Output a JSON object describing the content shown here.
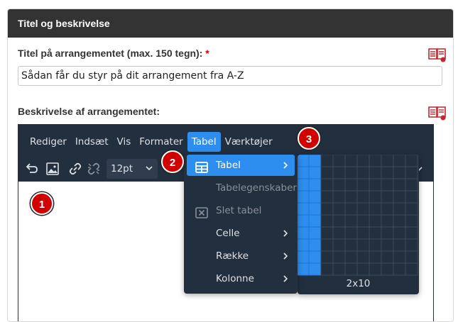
{
  "card": {
    "header": "Titel og beskrivelse"
  },
  "title_field": {
    "label": "Titel på arrangementet (max. 150 tegn):",
    "required_mark": "*",
    "value": "Sådan får du styr på dit arrangement fra A-Z"
  },
  "description_field": {
    "label": "Beskrivelse af arrangementet:"
  },
  "editor": {
    "menubar": [
      "Rediger",
      "Indsæt",
      "Vis",
      "Formater",
      "Tabel",
      "Værktøjer"
    ],
    "active_menu": "Tabel",
    "font_size": "12pt",
    "toolbar_icons": [
      "undo-icon",
      "image-icon",
      "link-icon",
      "unlink-icon"
    ]
  },
  "table_menu": {
    "items": [
      {
        "label": "Tabel",
        "icon": "table-icon",
        "submenu": true,
        "selected": true,
        "disabled": false
      },
      {
        "label": "Tabelegenskaber",
        "icon": "",
        "submenu": false,
        "selected": false,
        "disabled": true
      },
      {
        "label": "Slet tabel",
        "icon": "delete-table-icon",
        "submenu": false,
        "selected": false,
        "disabled": true
      },
      {
        "label": "Celle",
        "icon": "",
        "submenu": true,
        "selected": false,
        "disabled": false
      },
      {
        "label": "Række",
        "icon": "",
        "submenu": true,
        "selected": false,
        "disabled": false
      },
      {
        "label": "Kolonne",
        "icon": "",
        "submenu": true,
        "selected": false,
        "disabled": false
      }
    ]
  },
  "table_grid": {
    "columns": 10,
    "rows": 10,
    "selected_columns": 2,
    "selected_rows": 10,
    "size_label": "2x10"
  },
  "badges": [
    "1",
    "2",
    "3"
  ],
  "colors": {
    "header_bg": "#333333",
    "editor_bg": "#222f3e",
    "accent": "#2d8ef0",
    "badge": "#d00000",
    "required": "#d00000",
    "help_icon": "#c0272d"
  }
}
